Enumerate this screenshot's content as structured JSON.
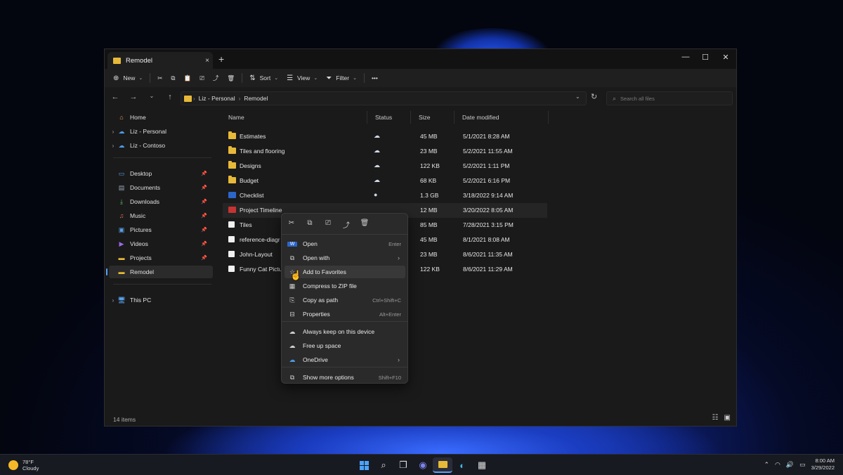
{
  "window": {
    "tab_title": "Remodel",
    "tab_close": "×",
    "new_tab": "+",
    "controls": [
      "—",
      "☐",
      "✕"
    ]
  },
  "toolbar": {
    "new_label": "New",
    "sort_label": "Sort",
    "view_label": "View",
    "filter_label": "Filter",
    "more_label": "•••"
  },
  "address": {
    "crumbs": [
      "Liz - Personal",
      "Remodel"
    ],
    "search_placeholder": "Search all files"
  },
  "sidebar": {
    "top_items": [
      {
        "label": "Home",
        "icon": "home-icon"
      },
      {
        "label": "Liz - Personal",
        "icon": "onedrive-icon"
      },
      {
        "label": "Liz - Contoso",
        "icon": "onedrive-icon"
      }
    ],
    "quick_items": [
      {
        "label": "Desktop",
        "icon": "desktop-icon"
      },
      {
        "label": "Documents",
        "icon": "documents-icon"
      },
      {
        "label": "Downloads",
        "icon": "download-icon"
      },
      {
        "label": "Music",
        "icon": "music-icon"
      },
      {
        "label": "Pictures",
        "icon": "pictures-icon"
      },
      {
        "label": "Videos",
        "icon": "videos-icon"
      },
      {
        "label": "Projects",
        "icon": "folder-icon"
      },
      {
        "label": "Remodel",
        "icon": "folder-icon"
      }
    ],
    "this_pc": "This PC"
  },
  "list": {
    "columns": [
      "Name",
      "Status",
      "Size",
      "Date modified"
    ],
    "rows": [
      {
        "name": "Estimates",
        "type": "folder",
        "status": "☁",
        "size": "45 MB",
        "date": "5/1/2021 8:28 AM"
      },
      {
        "name": "Tiles and flooring",
        "type": "folder",
        "status": "☁",
        "size": "23 MB",
        "date": "5/2/2021 11:55 AM"
      },
      {
        "name": "Designs",
        "type": "folder",
        "status": "☁",
        "size": "122 KB",
        "date": "5/2/2021 1:11 PM"
      },
      {
        "name": "Budget",
        "type": "folder",
        "status": "☁",
        "size": "68 KB",
        "date": "5/2/2021 6:16 PM"
      },
      {
        "name": "Checklist",
        "type": "word",
        "status": "●",
        "size": "1.3 GB",
        "date": "3/18/2022 9:14 AM"
      },
      {
        "name": "Project Timeline",
        "type": "pdf",
        "status": "",
        "size": "12 MB",
        "date": "3/20/2022 8:05 AM"
      },
      {
        "name": "Tiles",
        "type": "blank",
        "status": "",
        "size": "85 MB",
        "date": "7/28/2021 3:15 PM"
      },
      {
        "name": "reference-diagr",
        "type": "blank",
        "status": "",
        "size": "45 MB",
        "date": "8/1/2021 8:08 AM"
      },
      {
        "name": "John-Layout",
        "type": "blank",
        "status": "",
        "size": "23 MB",
        "date": "8/6/2021 11:35 AM"
      },
      {
        "name": "Funny Cat Pictu",
        "type": "blank",
        "status": "",
        "size": "122 KB",
        "date": "8/6/2021 11:29 AM"
      }
    ],
    "item_count": "14 items"
  },
  "context_menu": {
    "items": [
      {
        "label": "Open",
        "accel": "Enter",
        "icon": "word-icon"
      },
      {
        "label": "Open with",
        "accel": "›",
        "icon": "open-with-icon"
      },
      {
        "label": "Add to Favorites",
        "accel": "",
        "icon": "star-icon"
      },
      {
        "label": "Compress to ZIP file",
        "accel": "",
        "icon": "zip-icon"
      },
      {
        "label": "Copy as path",
        "accel": "Ctrl+Shift+C",
        "icon": "path-icon"
      },
      {
        "label": "Properties",
        "accel": "Alt+Enter",
        "icon": "properties-icon"
      },
      {
        "label": "Always keep on this device",
        "accel": "",
        "icon": "cloud-sync-icon"
      },
      {
        "label": "Free up space",
        "accel": "",
        "icon": "cloud-icon"
      },
      {
        "label": "OneDrive",
        "accel": "›",
        "icon": "onedrive-icon"
      },
      {
        "label": "Show more options",
        "accel": "Shift+F10",
        "icon": "more-options-icon"
      }
    ]
  },
  "taskbar": {
    "temp": "78°F",
    "weather": "Cloudy",
    "time": "8:00 AM",
    "date": "3/29/2022"
  }
}
